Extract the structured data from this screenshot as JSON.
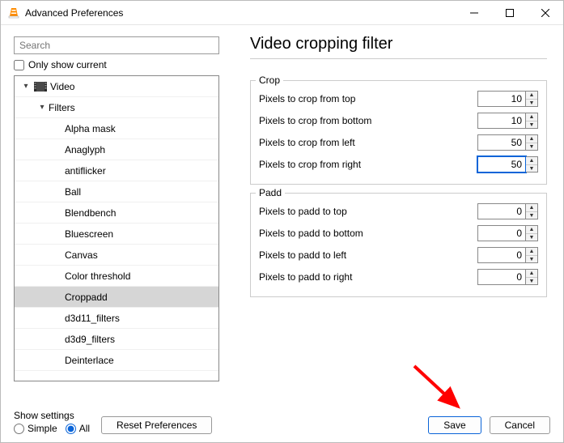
{
  "window": {
    "title": "Advanced Preferences",
    "min_tooltip": "Minimize",
    "max_tooltip": "Maximize",
    "close_tooltip": "Close"
  },
  "search": {
    "placeholder": "Search"
  },
  "only_show_current": "Only show current",
  "tree": {
    "video": "Video",
    "filters": "Filters",
    "items": [
      "Alpha mask",
      "Anaglyph",
      "antiflicker",
      "Ball",
      "Blendbench",
      "Bluescreen",
      "Canvas",
      "Color threshold",
      "Croppadd",
      "d3d11_filters",
      "d3d9_filters",
      "Deinterlace"
    ],
    "selected_index": 8
  },
  "page": {
    "title": "Video cropping filter",
    "group_crop": "Crop",
    "group_padd": "Padd",
    "crop": {
      "top": {
        "label": "Pixels to crop from top",
        "value": 10
      },
      "bottom": {
        "label": "Pixels to crop from bottom",
        "value": 10
      },
      "left": {
        "label": "Pixels to crop from left",
        "value": 50
      },
      "right": {
        "label": "Pixels to crop from right",
        "value": 50
      }
    },
    "padd": {
      "top": {
        "label": "Pixels to padd to top",
        "value": 0
      },
      "bottom": {
        "label": "Pixels to padd to bottom",
        "value": 0
      },
      "left": {
        "label": "Pixels to padd to left",
        "value": 0
      },
      "right": {
        "label": "Pixels to padd to right",
        "value": 0
      }
    }
  },
  "bottom": {
    "show_settings": "Show settings",
    "simple": "Simple",
    "all": "All",
    "reset": "Reset Preferences",
    "save": "Save",
    "cancel": "Cancel"
  }
}
